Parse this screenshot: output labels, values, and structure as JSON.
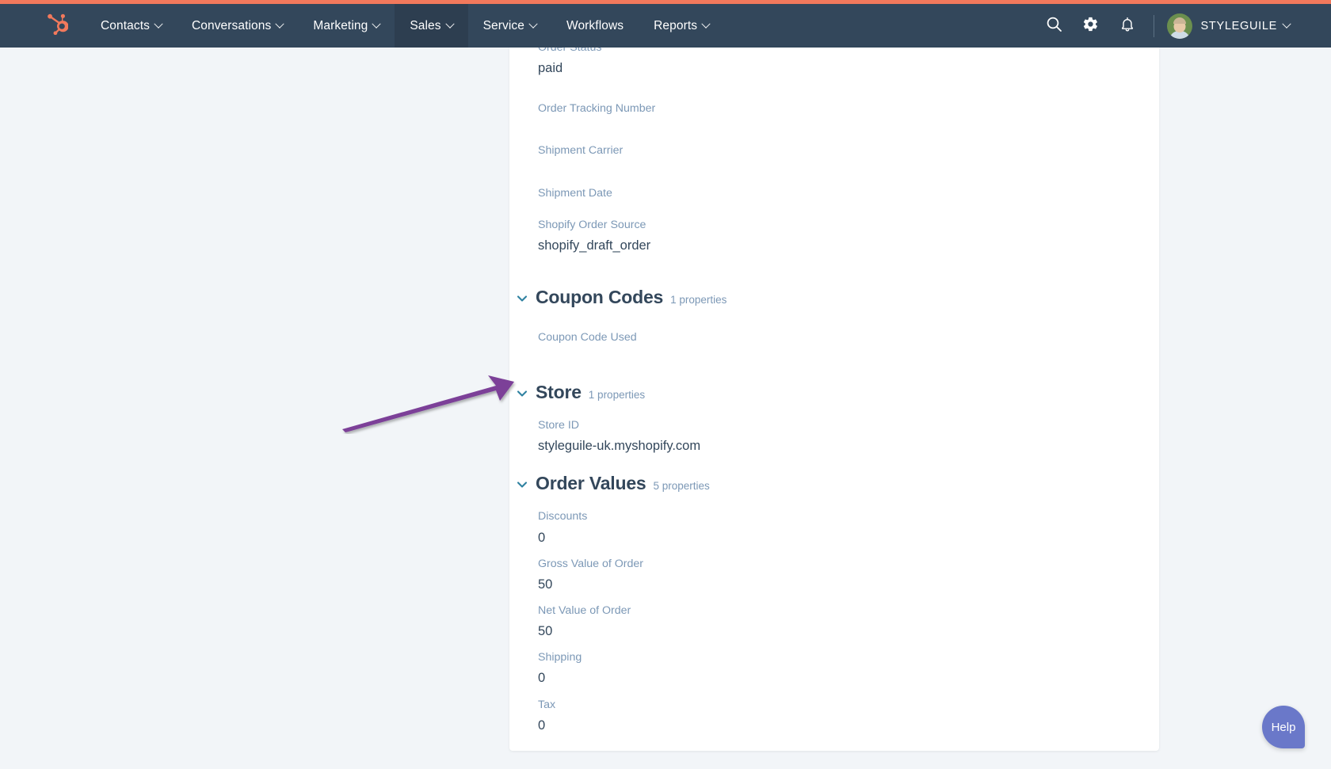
{
  "colors": {
    "accent_strip": "#f2795c",
    "navbar_bg": "#33475b",
    "page_bg": "#f2f5f8",
    "card_bg": "#ffffff",
    "label_text": "#7c98b6",
    "value_text": "#33475b",
    "chevron_teal": "#2e81a0",
    "annotation_purple": "#7b3f98",
    "help_purple": "#6a78c9"
  },
  "navbar": {
    "logo": "hubspot-sprocket-logo",
    "items": [
      {
        "label": "Contacts",
        "has_caret": true,
        "active": false
      },
      {
        "label": "Conversations",
        "has_caret": true,
        "active": false
      },
      {
        "label": "Marketing",
        "has_caret": true,
        "active": false
      },
      {
        "label": "Sales",
        "has_caret": true,
        "active": true
      },
      {
        "label": "Service",
        "has_caret": true,
        "active": false
      },
      {
        "label": "Workflows",
        "has_caret": false,
        "active": false
      },
      {
        "label": "Reports",
        "has_caret": true,
        "active": false
      }
    ],
    "icons": [
      {
        "name": "search-icon"
      },
      {
        "name": "gear-icon"
      },
      {
        "name": "bell-icon"
      }
    ],
    "account": {
      "avatar": "user-avatar-photo",
      "name": "STYLEGUILE",
      "has_caret": true
    }
  },
  "card": {
    "top_properties": [
      {
        "label": "Order Status",
        "value": "paid",
        "clipped": true
      },
      {
        "label": "Order Tracking Number",
        "value": ""
      },
      {
        "label": "Shipment Carrier",
        "value": ""
      },
      {
        "label": "Shipment Date",
        "value": ""
      },
      {
        "label": "Shopify Order Source",
        "value": "shopify_draft_order"
      }
    ],
    "sections": [
      {
        "title": "Coupon Codes",
        "count": "1 properties",
        "chevron": "chevron-down-icon",
        "properties": [
          {
            "label": "Coupon Code Used",
            "value": ""
          }
        ]
      },
      {
        "title": "Store",
        "count": "1 properties",
        "chevron": "chevron-down-icon",
        "properties": [
          {
            "label": "Store ID",
            "value": "styleguile-uk.myshopify.com"
          }
        ]
      },
      {
        "title": "Order Values",
        "count": "5 properties",
        "chevron": "chevron-down-icon",
        "properties": [
          {
            "label": "Discounts",
            "value": "0"
          },
          {
            "label": "Gross Value of Order",
            "value": "50"
          },
          {
            "label": "Net Value of Order",
            "value": "50"
          },
          {
            "label": "Shipping",
            "value": "0"
          },
          {
            "label": "Tax",
            "value": "0"
          }
        ]
      }
    ]
  },
  "annotation": {
    "name": "purple-arrow-annotation",
    "points_to": "Store ID"
  },
  "help": {
    "label": "Help"
  }
}
